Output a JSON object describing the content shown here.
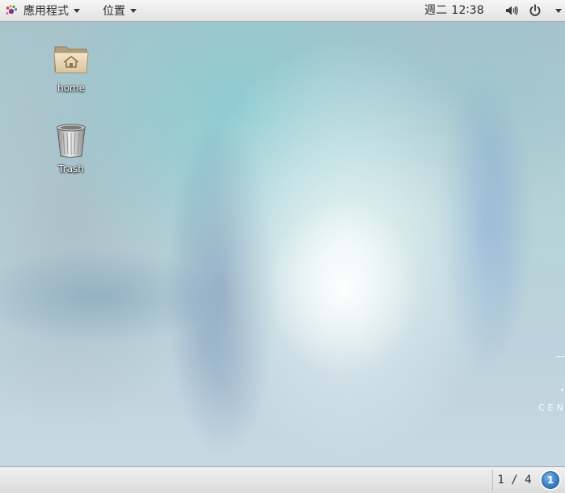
{
  "top_panel": {
    "applications_menu": {
      "label": "應用程式",
      "icon": "gnome-foot-icon"
    },
    "places_menu": {
      "label": "位置"
    },
    "clock": "週二 12∶38",
    "volume_icon": "volume-icon",
    "power_icon": "power-icon"
  },
  "desktop": {
    "icons": [
      {
        "label": "home",
        "icon": "home-folder-icon"
      },
      {
        "label": "Trash",
        "icon": "trash-icon"
      }
    ],
    "watermark_text": "CEN"
  },
  "bottom_panel": {
    "workspace_indicator": "1 / 4",
    "notification_count": "1"
  },
  "colors": {
    "panel_background": "#e9e9e9",
    "panel_text": "#2e2e2e",
    "badge_blue": "#3b82c8",
    "desktop_cyan": "#b6d3d8"
  }
}
